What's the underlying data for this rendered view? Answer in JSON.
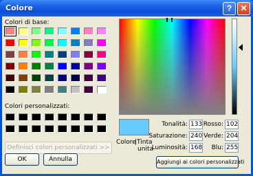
{
  "window": {
    "title": "Colore"
  },
  "titlebar": {
    "help": "?",
    "close": "✕"
  },
  "basic": {
    "label": "Colori di base:",
    "colors": [
      [
        "#ff8080",
        "#ffff80",
        "#80ff80",
        "#00ff80",
        "#80ffff",
        "#0080ff",
        "#ff80c0",
        "#ff80ff"
      ],
      [
        "#ff0000",
        "#ffff00",
        "#80ff00",
        "#00ff40",
        "#00ffff",
        "#0080c0",
        "#8080c0",
        "#ff00ff"
      ],
      [
        "#804040",
        "#ff8040",
        "#00ff00",
        "#008080",
        "#004080",
        "#8080ff",
        "#800040",
        "#ff0080"
      ],
      [
        "#800000",
        "#ff8000",
        "#008000",
        "#008040",
        "#0000ff",
        "#0000a0",
        "#800080",
        "#8000ff"
      ],
      [
        "#400000",
        "#804000",
        "#004000",
        "#004040",
        "#000080",
        "#000040",
        "#400040",
        "#400080"
      ],
      [
        "#000000",
        "#808000",
        "#808040",
        "#808080",
        "#408080",
        "#c0c0c0",
        "#400040",
        "#ffffff"
      ]
    ]
  },
  "custom": {
    "label": "Colori personalizzati:",
    "colors": [
      [
        "#000000",
        "#000000",
        "#000000",
        "#000000",
        "#000000",
        "#000000",
        "#000000",
        "#000000"
      ],
      [
        "#000000",
        "#000000",
        "#000000",
        "#000000",
        "#000000",
        "#000000",
        "#000000",
        "#000000"
      ]
    ]
  },
  "buttons": {
    "define": "Definisci colori personalizzati >>",
    "ok": "OK",
    "cancel": "Annulla",
    "add": "Aggiungi ai colori personalizzati"
  },
  "preview": {
    "color": "#66ccff",
    "label_colore": "Colore",
    "label_tinta_1": "|Tinta",
    "label_tinta_2": "unita"
  },
  "fields": {
    "hue": {
      "label": "Tonalità:",
      "value": "133"
    },
    "sat": {
      "label": "Saturazione:",
      "value": "240"
    },
    "lum": {
      "label": "Luminosità:",
      "value": "168"
    },
    "red": {
      "label": "Rosso:",
      "value": "102"
    },
    "green": {
      "label": "Verde:",
      "value": "204"
    },
    "blue": {
      "label": "Blu:",
      "value": "255"
    }
  }
}
